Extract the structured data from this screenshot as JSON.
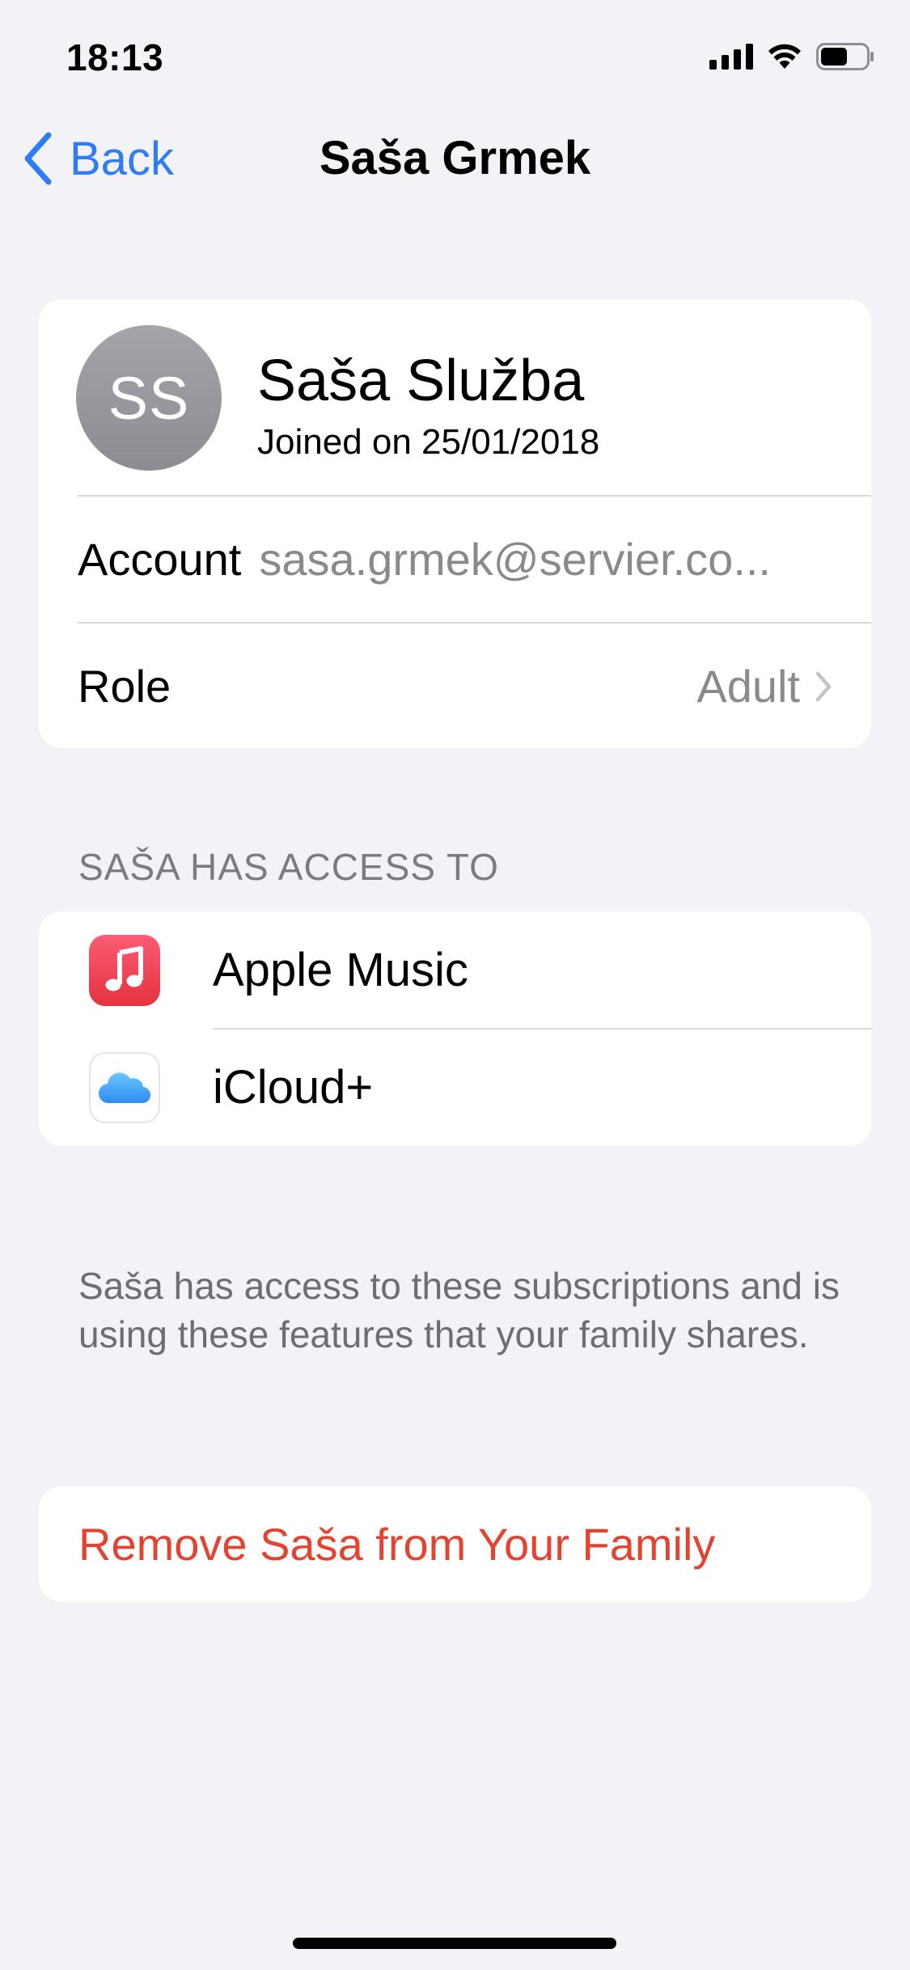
{
  "status_bar": {
    "time": "18:13",
    "icons": [
      "signal-icon",
      "wifi-icon",
      "battery-icon"
    ],
    "battery_level": 0.6
  },
  "nav": {
    "back_label": "Back",
    "title": "Saša Grmek",
    "accent_color": "#2f7cf6"
  },
  "profile": {
    "initials": "SS",
    "name": "Saša Služba",
    "joined": "Joined on 25/01/2018",
    "account_label": "Account",
    "account_value": "sasa.grmek@servier.co...",
    "role_label": "Role",
    "role_value": "Adult"
  },
  "access": {
    "header": "SAŠA HAS ACCESS TO",
    "items": [
      {
        "label": "Apple Music",
        "icon": "apple-music-icon"
      },
      {
        "label": "iCloud+",
        "icon": "icloud-icon"
      }
    ]
  },
  "footer_text": "Saša has access to these subscriptions and is using these features that your family shares.",
  "remove": {
    "label": "Remove Saša from Your Family",
    "color": "#e5432f"
  }
}
